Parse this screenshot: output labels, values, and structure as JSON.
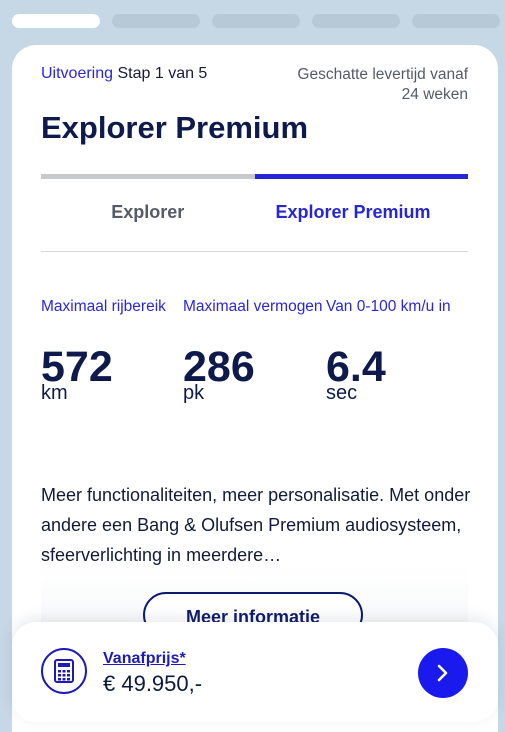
{
  "progress": {
    "total_segments": 5,
    "active_segment": 1
  },
  "header": {
    "phase": "Uitvoering",
    "step": "Stap 1 van 5",
    "delivery_line1": "Geschatte levertijd vanaf",
    "delivery_line2": "24 weken"
  },
  "model": {
    "title": "Explorer Premium"
  },
  "tabs": [
    {
      "label": "Explorer",
      "active": false
    },
    {
      "label": "Explorer Premium",
      "active": true
    }
  ],
  "specs": [
    {
      "label": "Maximaal rijbereik",
      "value": "572",
      "unit": "km"
    },
    {
      "label": "Maximaal vermogen",
      "value": "286",
      "unit": "pk"
    },
    {
      "label": "Van 0-100 km/u in",
      "value": "6.4",
      "unit": "sec"
    }
  ],
  "description": "Meer functionaliteiten, meer personalisatie. Met onder andere een Bang & Olufsen Premium audiosysteem, sfeerverlichting in meerdere…",
  "more_button": "Meer informatie",
  "price": {
    "label": "Vanafprijs*",
    "value": "€ 49.950,-"
  },
  "icons": {
    "calculator": "calculator-icon",
    "next": "chevron-right-icon"
  },
  "colors": {
    "accent": "#2626d4",
    "navy": "#0e1a4c",
    "background": "#c6d7e5"
  }
}
